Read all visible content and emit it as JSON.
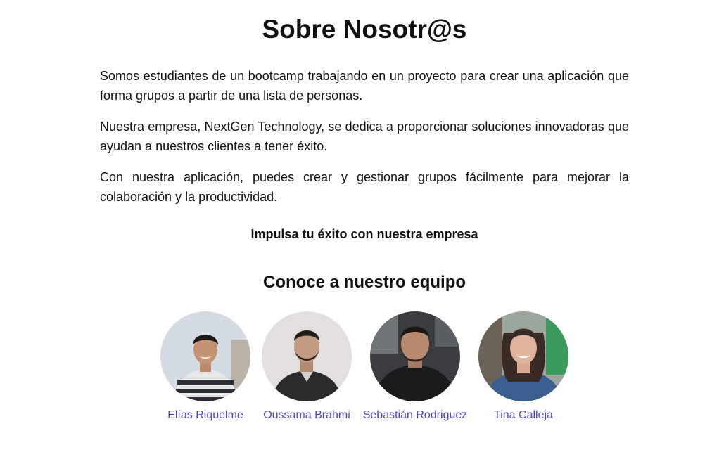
{
  "page": {
    "title": "Sobre Nosotr@s",
    "paragraphs": [
      "Somos estudiantes de un bootcamp trabajando en un proyecto para crear una aplicación que forma grupos a partir de una lista de personas.",
      "Nuestra empresa, NextGen Technology, se dedica a proporcionar soluciones innovadoras que ayudan a nuestros clientes a tener éxito.",
      "Con nuestra aplicación, puedes crear y gestionar grupos fácilmente para mejorar la colaboración y la productividad."
    ],
    "slogan": "Impulsa tu éxito con nuestra empresa"
  },
  "team": {
    "title": "Conoce a nuestro equipo",
    "members": [
      {
        "name": "Elías Riquelme"
      },
      {
        "name": "Oussama Brahmi"
      },
      {
        "name": "Sebastián Rodriguez"
      },
      {
        "name": "Tina Calleja"
      }
    ]
  },
  "colors": {
    "text": "#111111",
    "link": "#4b43c8",
    "background": "#ffffff"
  }
}
